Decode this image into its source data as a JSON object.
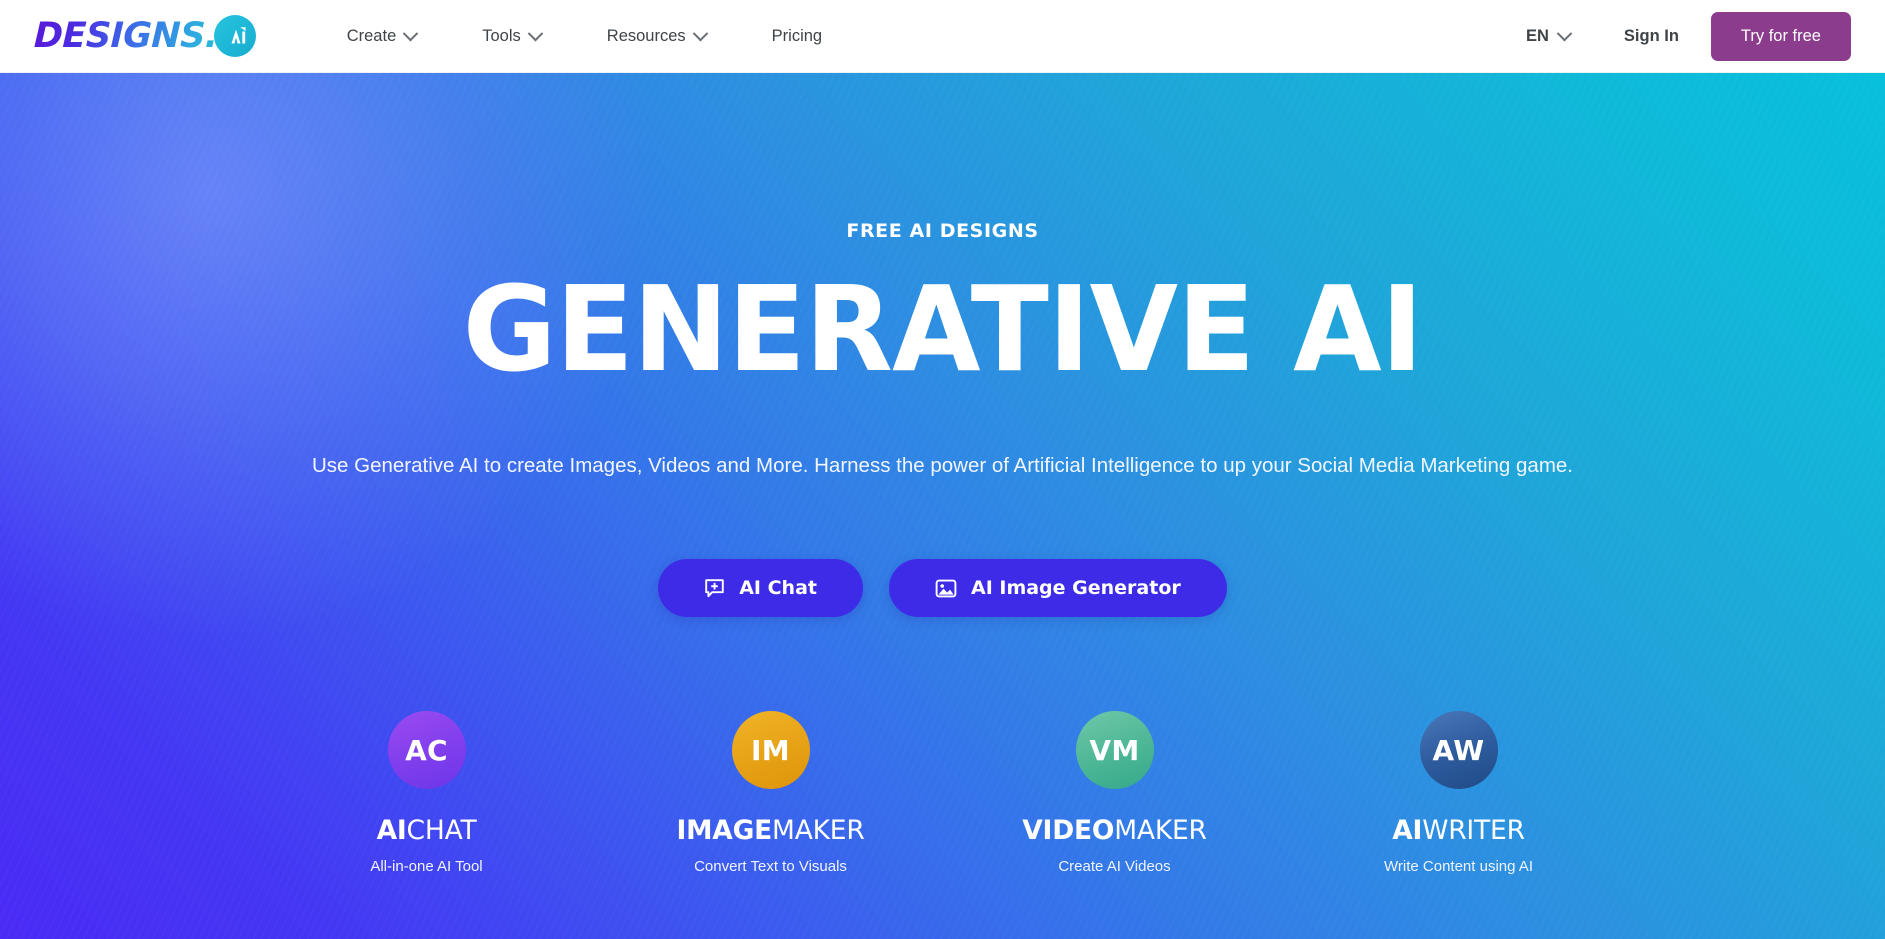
{
  "header": {
    "logo": {
      "text": "DESIGNS.",
      "badge_label": "AI",
      "badge_icon": "ai-monogram-icon"
    },
    "nav": [
      {
        "label": "Create",
        "has_dropdown": true
      },
      {
        "label": "Tools",
        "has_dropdown": true
      },
      {
        "label": "Resources",
        "has_dropdown": true
      },
      {
        "label": "Pricing",
        "has_dropdown": false
      }
    ],
    "language": {
      "label": "EN"
    },
    "sign_in_label": "Sign In",
    "try_label": "Try for free",
    "try_color": "#8C3C8C"
  },
  "hero": {
    "eyebrow": "FREE AI DESIGNS",
    "headline": "GENERATIVE AI",
    "subtitle": "Use Generative AI to create Images, Videos and More. Harness the power of Artificial Intelligence to up your Social Media Marketing game.",
    "gradient_from": "#4a2bf5",
    "gradient_to": "#06c0dc",
    "ctas": [
      {
        "label": "AI Chat",
        "icon": "chat-plus-icon",
        "color": "#3E2BE8"
      },
      {
        "label": "AI Image Generator",
        "icon": "image-icon",
        "color": "#3E2BE8"
      }
    ],
    "features": [
      {
        "badge": "AC",
        "badge_color": "#8540EE",
        "title_bold": "AI",
        "title_regular": "CHAT",
        "subtitle": "All-in-one AI Tool"
      },
      {
        "badge": "IM",
        "badge_color": "#E8A317",
        "title_bold": "IMAGE",
        "title_regular": "MAKER",
        "subtitle": "Convert Text to Visuals"
      },
      {
        "badge": "VM",
        "badge_color": "#4FB897",
        "title_bold": "VIDEO",
        "title_regular": "MAKER",
        "subtitle": "Create AI Videos"
      },
      {
        "badge": "AW",
        "badge_color": "#2E5C9E",
        "title_bold": "AI",
        "title_regular": "WRITER",
        "subtitle": "Write Content using AI"
      }
    ]
  }
}
